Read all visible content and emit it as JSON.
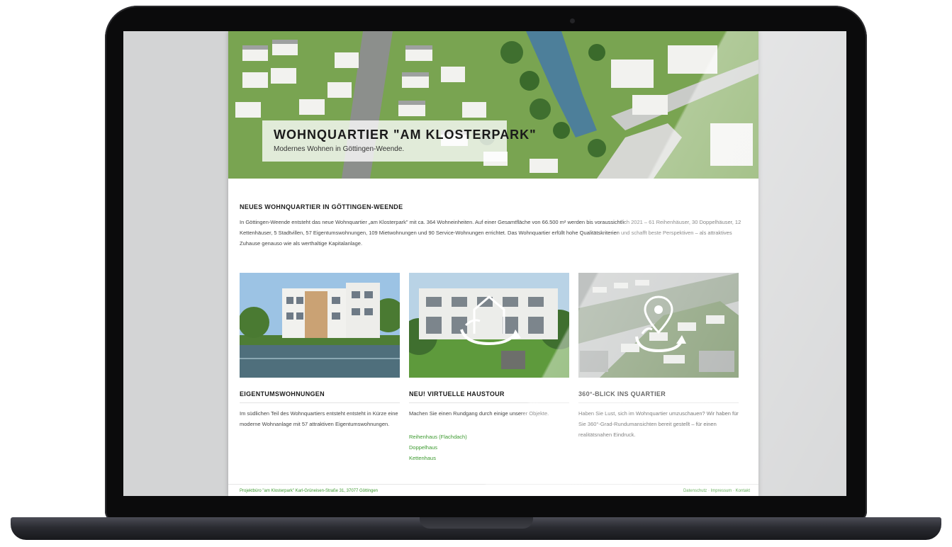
{
  "hero": {
    "title": "WOHNQUARTIER \"AM KLOSTERPARK\"",
    "subtitle": "Modernes Wohnen in Göttingen-Weende."
  },
  "intro": {
    "heading": "NEUES WOHNQUARTIER IN GÖTTINGEN-WEENDE",
    "text": "In Göttingen-Weende entsteht das neue Wohnquartier „am Klosterpark\" mit ca. 364 Wohneinheiten. Auf einer Gesamtfläche von 66.500 m² werden bis voraussichtlich 2021 – 61 Reihenhäuser, 30 Doppelhäuser, 12 Kettenhäuser, 5 Stadtvillen, 57 Eigentumswohnungen, 109 Mietwohnungen und 90 Service-Wohnungen errichtet. Das Wohnquartier erfüllt hohe Qualitätskriterien und schafft beste Perspektiven – als attraktives Zuhause genauso wie als werthaltige Kapitalanlage."
  },
  "cards": [
    {
      "heading": "EIGENTUMSWOHNUNGEN",
      "text": "Im südlichen Teil des Wohnquartiers entsteht entsteht in Kürze eine moderne Wohnanlage mit 57 attraktiven Eigentumswohnungen.",
      "links": []
    },
    {
      "heading": "NEU! VIRTUELLE HAUSTOUR",
      "text": "Machen Sie einen Rundgang durch einige unserer Objekte.",
      "links": [
        "Reihenhaus (Flachdach)",
        "Doppelhaus",
        "Kettenhaus"
      ]
    },
    {
      "heading": "360°-BLICK INS QUARTIER",
      "text": "Haben Sie Lust, sich im Wohnquartier umzuschauen? Wir haben für Sie 360°-Grad-Rundumansichten bereit gestellt – für einen realitätsnahen Eindruck.",
      "links": []
    }
  ],
  "footer": {
    "left": "Projektbüro \"am Klosterpark\" Karl-Grüneisen-Straße 31, 37077 Göttingen",
    "right": "Datenschutz · Impressum · Kontakt"
  },
  "colors": {
    "accent_green": "#3c9a2f",
    "bezel": "#0b0b0c",
    "screen_bg": "#d3d4d5"
  }
}
